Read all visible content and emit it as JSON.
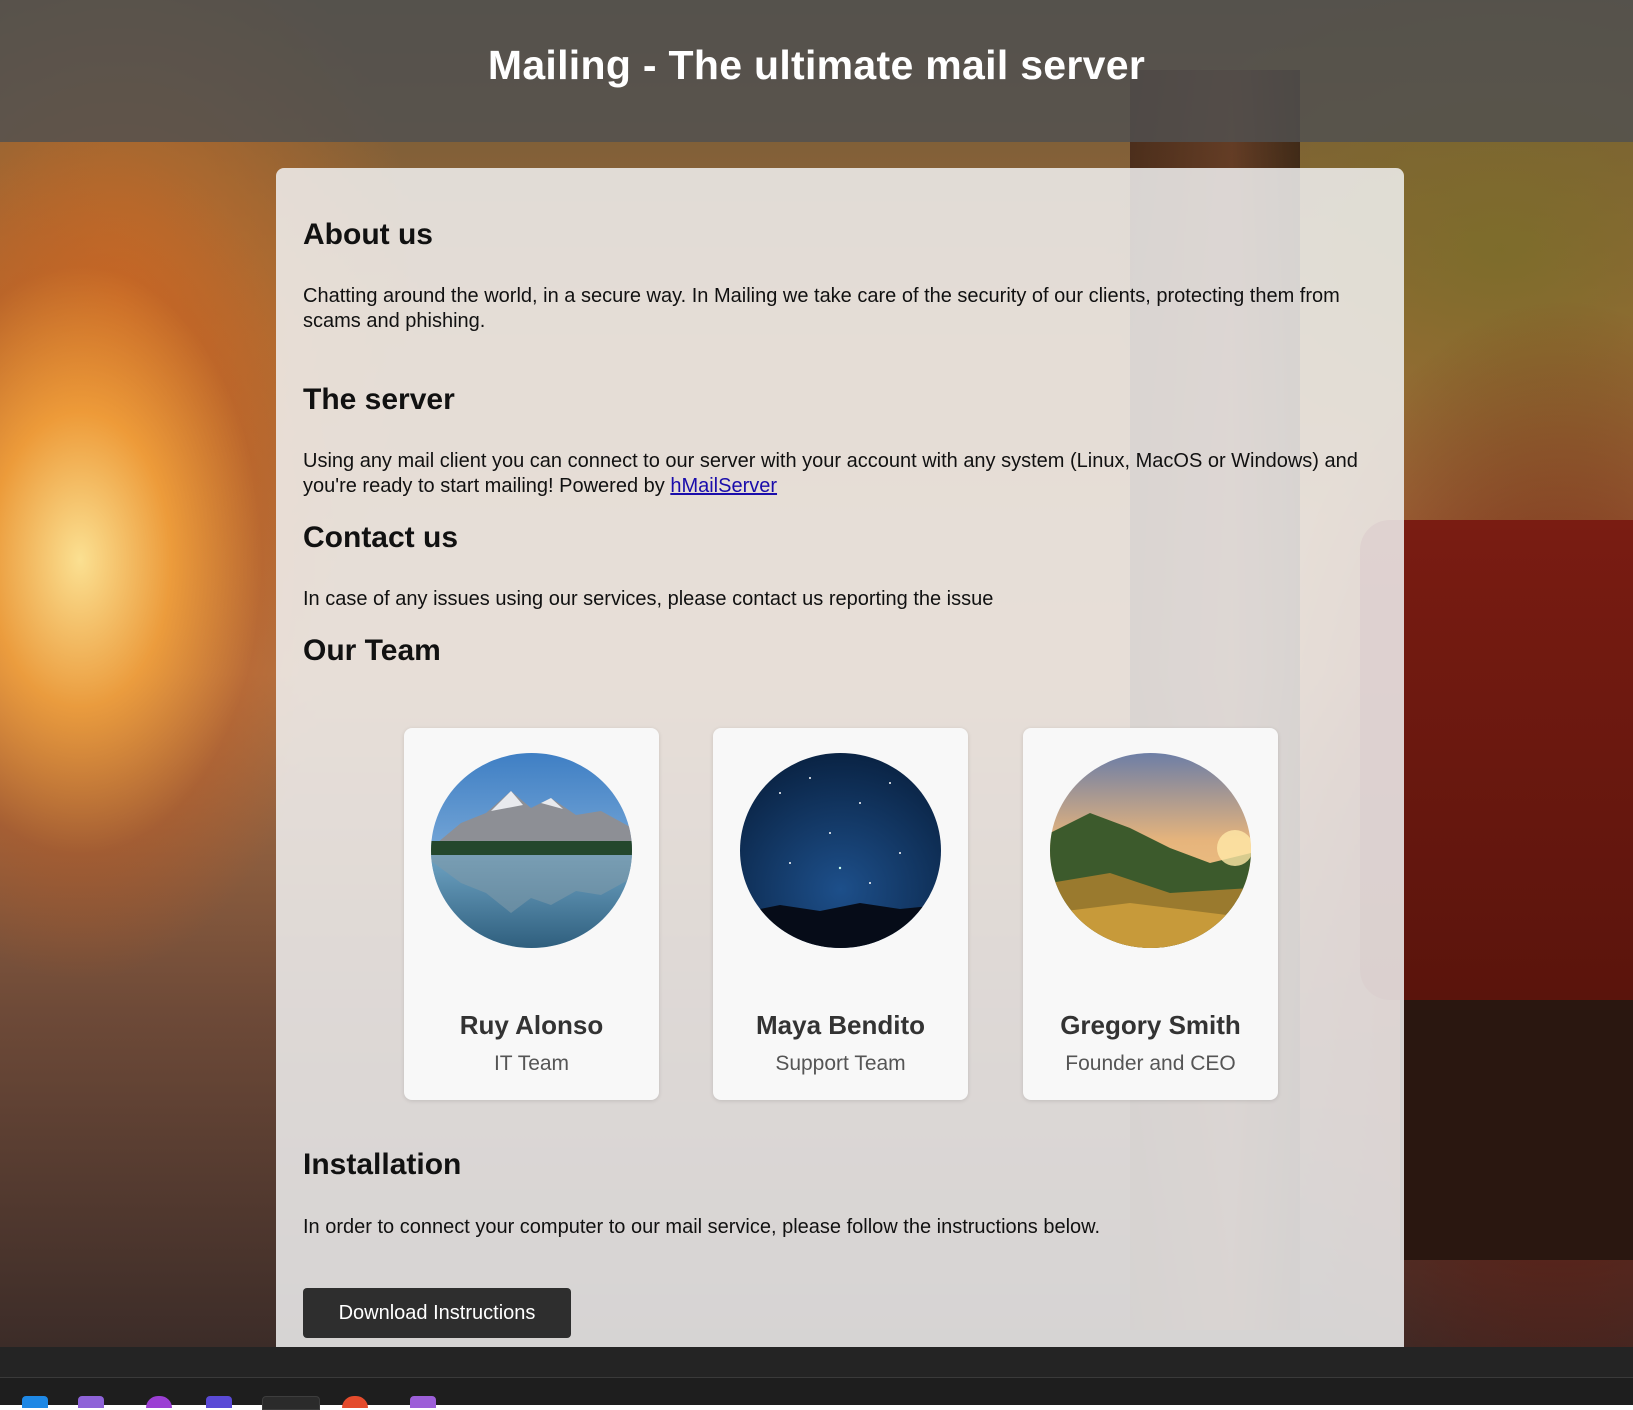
{
  "header": {
    "title": "Mailing - The ultimate mail server"
  },
  "about": {
    "title": "About us",
    "text": "Chatting around the world, in a secure way. In Mailing we take care of the security of our clients, protecting them from scams and phishing."
  },
  "server": {
    "title": "The server",
    "text_before_link": "Using any mail client you can connect to our server with your account with any system (Linux, MacOS or Windows) and you're ready to start mailing! Powered by ",
    "link_text": "hMailServer"
  },
  "contact": {
    "title": "Contact us",
    "text": "In case of any issues using our services, please contact us reporting the issue"
  },
  "team": {
    "title": "Our Team",
    "members": [
      {
        "name": "Ruy Alonso",
        "role": "IT Team"
      },
      {
        "name": "Maya Bendito",
        "role": "Support Team"
      },
      {
        "name": "Gregory Smith",
        "role": "Founder and CEO"
      }
    ]
  },
  "installation": {
    "title": "Installation",
    "text": "In order to connect your computer to our mail service, please follow the instructions below.",
    "button_label": "Download Instructions"
  },
  "colors": {
    "header_bg": "#505050",
    "panel_bg": "#f0f0f0",
    "button_bg": "#2e2e2e",
    "link": "#1a0dab"
  },
  "taskbar": {
    "icons": [
      "vscode-icon",
      "visual-studio-icon",
      "browser-icon",
      "app-icon",
      "terminal-icon",
      "chrome-icon",
      "vs-icon"
    ]
  }
}
